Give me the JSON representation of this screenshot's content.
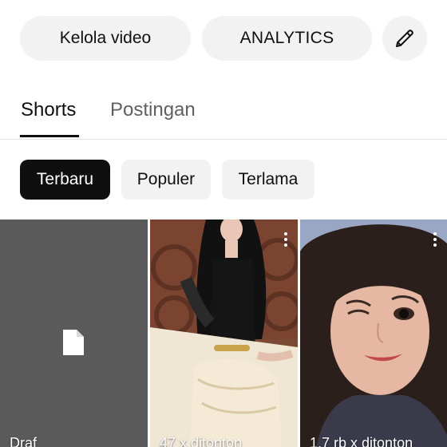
{
  "header": {
    "manage_label": "Kelola video",
    "analytics_label": "ANALYTICS",
    "edit_icon": "pencil-icon"
  },
  "tabs": [
    {
      "label": "Shorts",
      "selected": true
    },
    {
      "label": "Postingan",
      "selected": false
    }
  ],
  "filters": [
    {
      "label": "Terbaru",
      "selected": true
    },
    {
      "label": "Populer",
      "selected": false
    },
    {
      "label": "Terlama",
      "selected": false
    }
  ],
  "videos": [
    {
      "caption": "Draf",
      "icon": "file-icon"
    },
    {
      "caption": "47 x ditonton",
      "icon": "more-vert-icon"
    },
    {
      "caption": "1,7 rb x ditonton",
      "icon": "more-vert-icon"
    }
  ],
  "colors": {
    "pill_bg": "#f2f2f2",
    "chip_selected_bg": "#0f0f0f",
    "text_primary": "#0f0f0f",
    "text_secondary": "#606060",
    "draft_tile_bg": "#5a5a5a"
  }
}
